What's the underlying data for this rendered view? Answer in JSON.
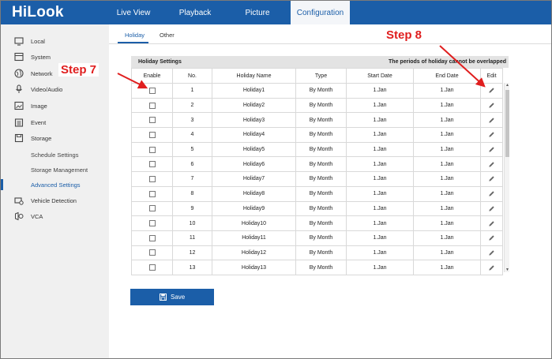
{
  "app": {
    "logo": "HiLook",
    "nav_tabs": [
      {
        "label": "Live View"
      },
      {
        "label": "Playback"
      },
      {
        "label": "Picture"
      },
      {
        "label": "Configuration"
      }
    ]
  },
  "sidebar": {
    "items": [
      {
        "label": "Local",
        "icon": "monitor-icon"
      },
      {
        "label": "System",
        "icon": "system-icon"
      },
      {
        "label": "Network",
        "icon": "globe-icon"
      },
      {
        "label": "Video/Audio",
        "icon": "microphone-icon"
      },
      {
        "label": "Image",
        "icon": "image-icon"
      },
      {
        "label": "Event",
        "icon": "calendar-icon"
      },
      {
        "label": "Storage",
        "icon": "floppy-icon"
      }
    ],
    "storage_subitems": [
      {
        "label": "Schedule Settings"
      },
      {
        "label": "Storage Management"
      },
      {
        "label": "Advanced Settings"
      }
    ],
    "lower_items": [
      {
        "label": "Vehicle Detection",
        "icon": "vehicle-detection-icon"
      },
      {
        "label": "VCA",
        "icon": "vca-icon"
      }
    ]
  },
  "subtabs": [
    {
      "label": "Holiday"
    },
    {
      "label": "Other"
    }
  ],
  "table": {
    "title": "Holiday Settings",
    "note": "The periods of holiday cannot be overlapped",
    "headers": [
      "Enable",
      "No.",
      "Holiday Name",
      "Type",
      "Start Date",
      "End Date",
      "Edit"
    ],
    "rows": [
      {
        "no": "1",
        "name": "Holiday1",
        "type": "By Month",
        "start": "1.Jan",
        "end": "1.Jan"
      },
      {
        "no": "2",
        "name": "Holiday2",
        "type": "By Month",
        "start": "1.Jan",
        "end": "1.Jan"
      },
      {
        "no": "3",
        "name": "Holiday3",
        "type": "By Month",
        "start": "1.Jan",
        "end": "1.Jan"
      },
      {
        "no": "4",
        "name": "Holiday4",
        "type": "By Month",
        "start": "1.Jan",
        "end": "1.Jan"
      },
      {
        "no": "5",
        "name": "Holiday5",
        "type": "By Month",
        "start": "1.Jan",
        "end": "1.Jan"
      },
      {
        "no": "6",
        "name": "Holiday6",
        "type": "By Month",
        "start": "1.Jan",
        "end": "1.Jan"
      },
      {
        "no": "7",
        "name": "Holiday7",
        "type": "By Month",
        "start": "1.Jan",
        "end": "1.Jan"
      },
      {
        "no": "8",
        "name": "Holiday8",
        "type": "By Month",
        "start": "1.Jan",
        "end": "1.Jan"
      },
      {
        "no": "9",
        "name": "Holiday9",
        "type": "By Month",
        "start": "1.Jan",
        "end": "1.Jan"
      },
      {
        "no": "10",
        "name": "Holiday10",
        "type": "By Month",
        "start": "1.Jan",
        "end": "1.Jan"
      },
      {
        "no": "11",
        "name": "Holiday11",
        "type": "By Month",
        "start": "1.Jan",
        "end": "1.Jan"
      },
      {
        "no": "12",
        "name": "Holiday12",
        "type": "By Month",
        "start": "1.Jan",
        "end": "1.Jan"
      },
      {
        "no": "13",
        "name": "Holiday13",
        "type": "By Month",
        "start": "1.Jan",
        "end": "1.Jan"
      }
    ]
  },
  "save_label": "Save",
  "annotations": {
    "step7": "Step 7",
    "step8": "Step 8"
  },
  "colors": {
    "brand_blue": "#1b5ea8",
    "annotation_red": "#e01e1e"
  }
}
